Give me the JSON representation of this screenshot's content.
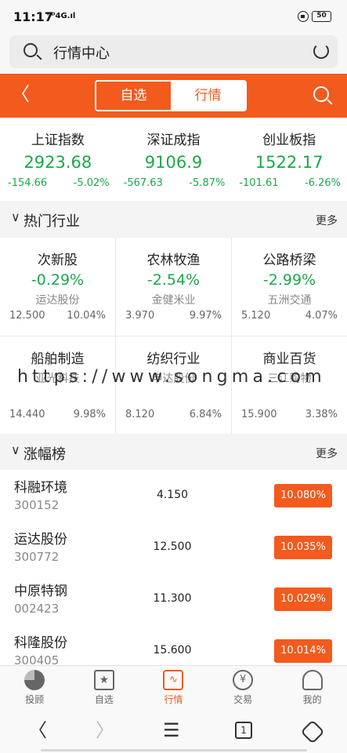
{
  "status": {
    "time": "11:17",
    "signal": "ᴴᴰ4G.ıl",
    "battery": "50"
  },
  "search": {
    "title": "行情中心"
  },
  "header": {
    "tabs": [
      "自选",
      "行情"
    ],
    "active_tab": 1
  },
  "indices": [
    {
      "name": "上证指数",
      "value": "2923.68",
      "change": "-154.66",
      "percent": "-5.02%"
    },
    {
      "name": "深证成指",
      "value": "9106.9",
      "change": "-567.63",
      "percent": "-5.87%"
    },
    {
      "name": "创业板指",
      "value": "1522.17",
      "change": "-101.61",
      "percent": "-6.26%"
    }
  ],
  "hot_section": {
    "title": "热门行业",
    "more": "更多"
  },
  "industries": [
    {
      "name": "次新股",
      "percent": "-0.29%",
      "stock": "运达股份",
      "price": "12.500",
      "stock_percent": "10.04%"
    },
    {
      "name": "农林牧渔",
      "percent": "-2.54%",
      "stock": "金健米业",
      "price": "3.970",
      "stock_percent": "9.97%"
    },
    {
      "name": "公路桥梁",
      "percent": "-2.99%",
      "stock": "五洲交通",
      "price": "5.120",
      "stock_percent": "4.07%"
    },
    {
      "name": "船舶制造",
      "percent": "",
      "stock": "亚光科技",
      "price": "14.440",
      "stock_percent": "9.98%"
    },
    {
      "name": "纺织行业",
      "percent": "",
      "stock": "申达股份",
      "price": "8.120",
      "stock_percent": "6.84%"
    },
    {
      "name": "商业百货",
      "percent": "",
      "stock": "三江购物",
      "price": "15.900",
      "stock_percent": "3.38%"
    }
  ],
  "watermark": "https://www.songma.com",
  "gainers_section": {
    "title": "涨幅榜",
    "more": "更多"
  },
  "gainers": [
    {
      "name": "科融环境",
      "code": "300152",
      "price": "4.150",
      "percent": "10.080%"
    },
    {
      "name": "运达股份",
      "code": "300772",
      "price": "12.500",
      "percent": "10.035%"
    },
    {
      "name": "中原特钢",
      "code": "002423",
      "price": "11.300",
      "percent": "10.029%"
    },
    {
      "name": "科隆股份",
      "code": "300405",
      "price": "15.600",
      "percent": "10.014%"
    }
  ],
  "tabbar": [
    {
      "label": "投顾",
      "icon": "pie-chart-icon"
    },
    {
      "label": "自选",
      "icon": "star-icon"
    },
    {
      "label": "行情",
      "icon": "market-chart-icon"
    },
    {
      "label": "交易",
      "icon": "yen-icon"
    },
    {
      "label": "我的",
      "icon": "user-icon"
    }
  ],
  "tabbar_active": 2,
  "navbar": {
    "tab_count": "1"
  },
  "colors": {
    "accent": "#f35a1d",
    "down": "#1ba84a"
  }
}
